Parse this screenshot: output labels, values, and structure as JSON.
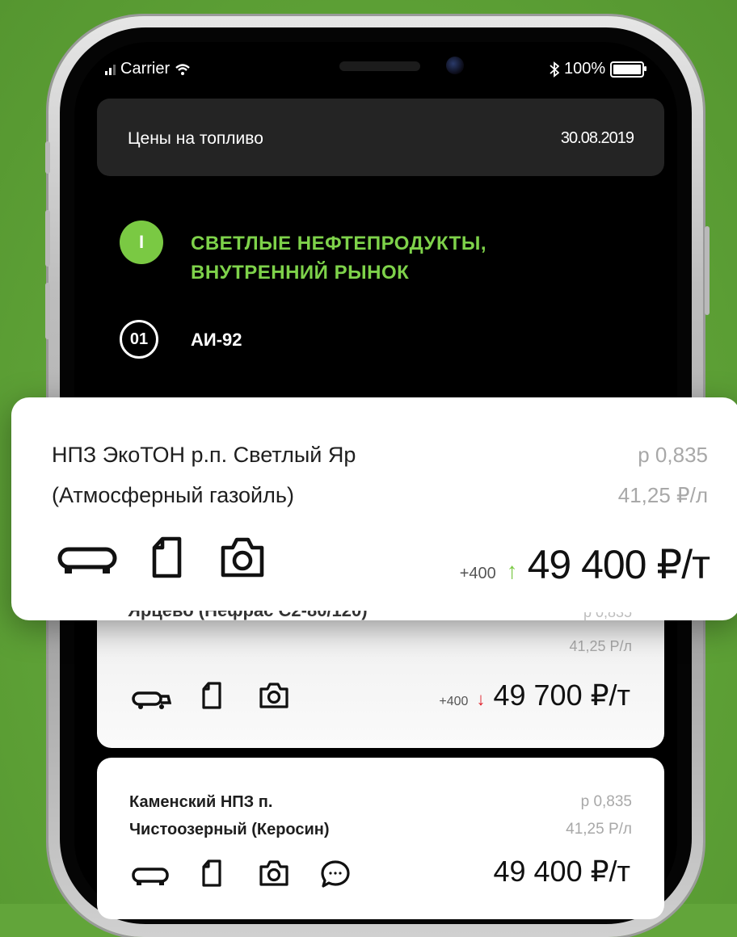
{
  "status_bar": {
    "carrier": "Carrier",
    "battery": "100%"
  },
  "header": {
    "title": "Цены на топливо",
    "date": "30.08.2019"
  },
  "section": {
    "badge": "I",
    "title_line1": "СВЕТЛЫЕ НЕФТЕПРОДУКТЫ,",
    "title_line2": "ВНУТРЕННИЙ РЫНОК"
  },
  "product": {
    "number": "01",
    "name": "АИ-92"
  },
  "cards": [
    {
      "name_line1": "НПЗ ЭкоТОН р.п. Светлый Яр",
      "name_line2": "(Атмосферный газойль)",
      "ratio": "р 0,835",
      "per_liter": "41,25 ₽/л",
      "delta": "+400",
      "trend": "up",
      "price": "49 400 ₽/т"
    },
    {
      "name_line1": "Ярцево (Нефрас С2-80/120)",
      "ratio": "р 0,835",
      "per_liter": "41,25 Р/л",
      "delta": "+400",
      "trend": "down",
      "price": "49 700 ₽/т"
    },
    {
      "name_line1": "Каменский НПЗ п.",
      "name_line2": "Чистоозерный (Керосин)",
      "ratio": "р 0,835",
      "per_liter": "41,25 Р/л",
      "price": "49 400 ₽/т"
    }
  ],
  "colors": {
    "accent": "#7ac943",
    "down": "#e0202a",
    "background": "#62a53a"
  },
  "icons": [
    "signal-icon",
    "wifi-icon",
    "bluetooth-icon",
    "battery-icon",
    "tank-truck-icon",
    "document-icon",
    "camera-icon",
    "chat-icon",
    "arrow-up-icon",
    "arrow-down-icon"
  ]
}
